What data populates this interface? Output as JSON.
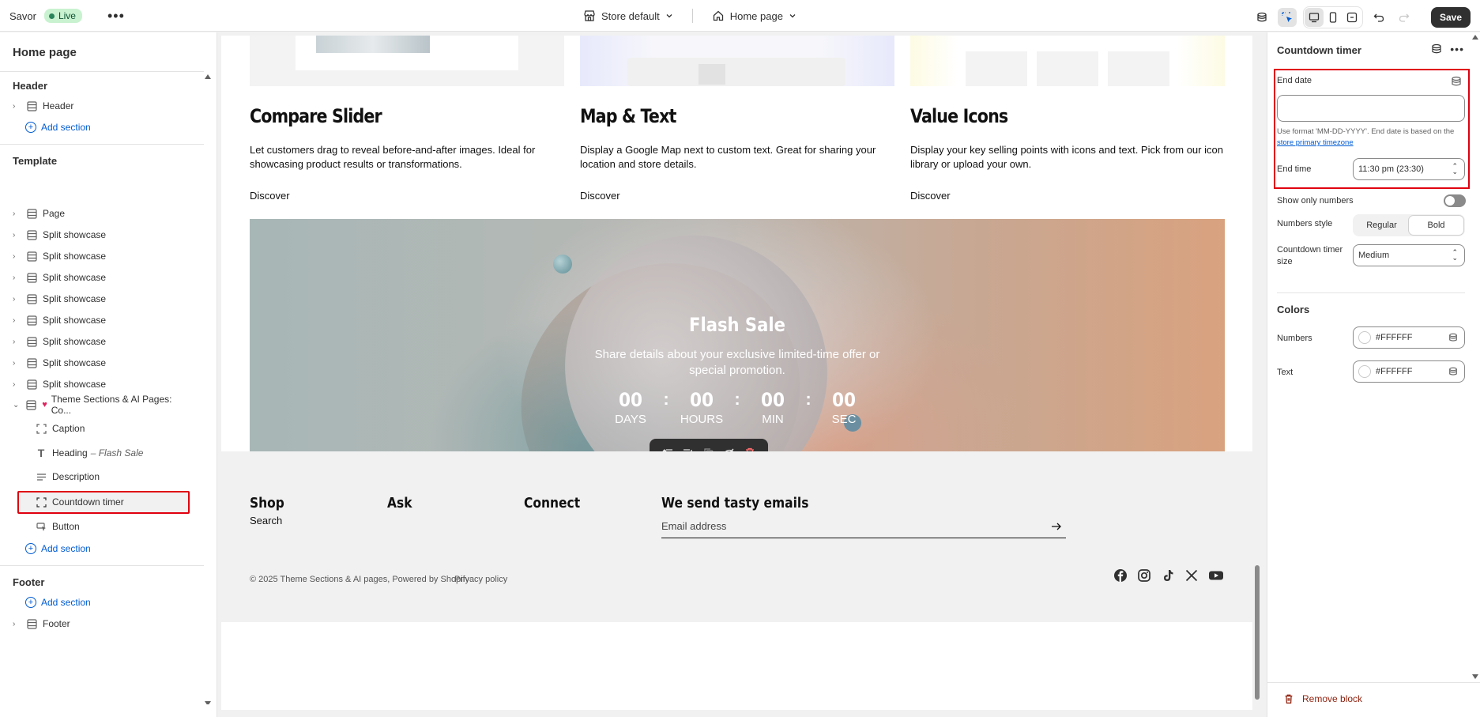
{
  "topbar": {
    "store_name": "Savor",
    "live_label": "Live",
    "store_selector": "Store default",
    "page_selector": "Home page",
    "save_label": "Save"
  },
  "left_panel": {
    "title": "Home page",
    "header_group": "Header",
    "header_item": "Header",
    "add_section": "Add section",
    "template_group": "Template",
    "template_items": [
      "Page",
      "Split showcase",
      "Split showcase",
      "Split showcase",
      "Split showcase",
      "Split showcase",
      "Split showcase",
      "Split showcase",
      "Split showcase"
    ],
    "theme_section": "Theme Sections & AI Pages: Co...",
    "blocks": {
      "caption": "Caption",
      "heading": "Heading",
      "heading_suffix": "– Flash Sale",
      "description": "Description",
      "countdown": "Countdown timer",
      "button": "Button"
    },
    "footer_group": "Footer",
    "footer_item": "Footer"
  },
  "preview": {
    "features": [
      {
        "title": "Compare Slider",
        "text": "Let customers drag to reveal before-and-after images. Ideal for showcasing product results or transformations.",
        "link": "Discover"
      },
      {
        "title": "Map & Text",
        "text": "Display a Google Map next to custom text. Great for sharing your location and store details.",
        "link": "Discover"
      },
      {
        "title": "Value Icons",
        "text": "Display your key selling points with icons and text. Pick from our icon library or upload your own.",
        "link": "Discover"
      }
    ],
    "hero": {
      "title": "Flash Sale",
      "subtitle": "Share details about your exclusive limited-time offer or special promotion.",
      "countdown": [
        {
          "value": "00",
          "label": "DAYS"
        },
        {
          "value": "00",
          "label": "HOURS"
        },
        {
          "value": "00",
          "label": "MIN"
        },
        {
          "value": "00",
          "label": "SEC"
        }
      ],
      "separator": ":"
    },
    "footer": {
      "shop": "Shop",
      "search": "Search",
      "ask": "Ask",
      "connect": "Connect",
      "newsletter": "We send tasty emails",
      "email_placeholder": "Email address",
      "copyright": "© 2025 Theme Sections & AI pages, Powered by Shopify",
      "privacy": "Privacy policy"
    }
  },
  "right_panel": {
    "title": "Countdown timer",
    "end_date_label": "End date",
    "end_date_value": "",
    "help_text": "Use format 'MM-DD-YYYY'. End date is based on the",
    "help_link": "store primary timezone",
    "end_time_label": "End time",
    "end_time_value": "11:30 pm (23:30)",
    "show_only_numbers_label": "Show only numbers",
    "show_only_numbers": false,
    "numbers_style_label": "Numbers style",
    "numbers_style_options": [
      "Regular",
      "Bold"
    ],
    "numbers_style_selected": "Bold",
    "timer_size_label": "Countdown timer size",
    "timer_size_value": "Medium",
    "colors_heading": "Colors",
    "numbers_color_label": "Numbers",
    "numbers_color": "#FFFFFF",
    "text_color_label": "Text",
    "text_color": "#FFFFFF",
    "remove_label": "Remove block"
  },
  "colors": {
    "accent_red": "#e0000f",
    "link_blue": "#005bd3",
    "live_green": "#29845a"
  }
}
